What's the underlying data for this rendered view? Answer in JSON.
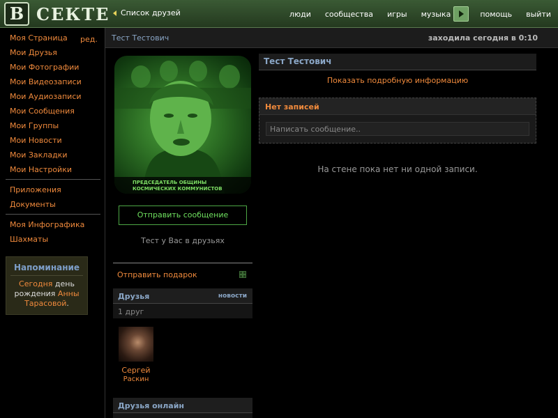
{
  "header": {
    "logo_letter": "B",
    "logo_text": "СЕКТЕ",
    "friends_list_link": "Список друзей",
    "nav": [
      "люди",
      "сообщества",
      "игры",
      "музыка",
      "помощь",
      "выйти"
    ]
  },
  "sidebar": {
    "edit_label": "ред.",
    "group1": [
      "Моя Страница",
      "Мои Друзья",
      "Мои Фотографии",
      "Мои Видеозаписи",
      "Мои Аудиозаписи",
      "Мои Сообщения",
      "Мои Группы",
      "Мои Новости",
      "Мои Закладки",
      "Мои Настройки"
    ],
    "group2": [
      "Приложения",
      "Документы"
    ],
    "group3": [
      "Моя Инфографика",
      "Шахматы"
    ],
    "reminder": {
      "title": "Напоминание",
      "today": "Сегодня",
      "text_middle": " день рождения ",
      "name": "Анны Тарасовой",
      "end": "."
    }
  },
  "profile": {
    "name": "Тест Тестович",
    "last_seen": "заходила сегодня в 0:10",
    "photo_caption_line1": "ПРЕДСЕДАТЕЛЬ ОБЩИНЫ",
    "photo_caption_line2": "КОСМИЧЕСКИХ КОММУНИСТОВ",
    "send_message": "Отправить сообщение",
    "in_friends": "Тест у Вас в друзьях",
    "send_gift": "Отправить подарок",
    "friends_title": "Друзья",
    "friends_news": "новости",
    "friends_count": "1 друг",
    "friend": {
      "first": "Сергей",
      "last": "Раскин"
    },
    "online_title": "Друзья онлайн"
  },
  "wall": {
    "show_info": "Показать подробную информацию",
    "no_posts": "Нет записей",
    "input_placeholder": "Написать сообщение..",
    "empty_text": "На стене пока нет ни одной записи."
  },
  "colors": {
    "link": "#f08a3c",
    "title_blue": "#8aa6c6",
    "header_green": "#3a5a34",
    "button_green": "#4da845"
  }
}
